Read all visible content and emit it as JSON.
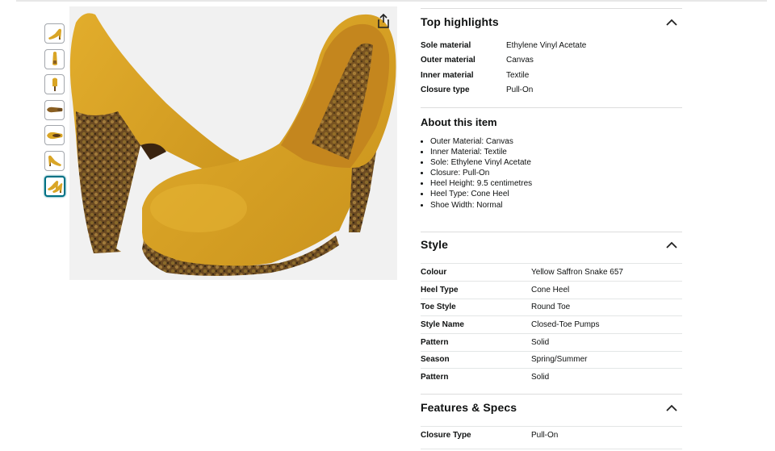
{
  "share": {
    "icon": "share-icon"
  },
  "thumbnails": [
    {
      "icon": "shoe-side-icon",
      "selected": false
    },
    {
      "icon": "shoe-front-icon",
      "selected": false
    },
    {
      "icon": "shoe-back-icon",
      "selected": false
    },
    {
      "icon": "shoe-sole-icon",
      "selected": false
    },
    {
      "icon": "shoe-top-icon",
      "selected": false
    },
    {
      "icon": "shoe-side-icon",
      "selected": false
    },
    {
      "icon": "shoe-pair-icon",
      "selected": true
    }
  ],
  "top_highlights": {
    "title": "Top highlights",
    "rows": [
      {
        "label": "Sole material",
        "value": "Ethylene Vinyl Acetate"
      },
      {
        "label": "Outer material",
        "value": "Canvas"
      },
      {
        "label": "Inner material",
        "value": "Textile"
      },
      {
        "label": "Closure type",
        "value": "Pull-On"
      }
    ]
  },
  "about": {
    "title": "About this item",
    "bullets": [
      "Outer Material: Canvas",
      "Inner Material: Textile",
      "Sole: Ethylene Vinyl Acetate",
      "Closure: Pull-On",
      "Heel Height: 9.5 centimetres",
      "Heel Type: Cone Heel",
      "Shoe Width: Normal"
    ]
  },
  "style": {
    "title": "Style",
    "rows": [
      {
        "label": "Colour",
        "value": "Yellow Saffron Snake 657"
      },
      {
        "label": "Heel Type",
        "value": "Cone Heel"
      },
      {
        "label": "Toe Style",
        "value": "Round Toe"
      },
      {
        "label": "Style Name",
        "value": "Closed-Toe Pumps"
      },
      {
        "label": "Pattern",
        "value": "Solid"
      },
      {
        "label": "Season",
        "value": "Spring/Summer"
      },
      {
        "label": "Pattern",
        "value": "Solid"
      }
    ]
  },
  "features": {
    "title": "Features & Specs",
    "rows": [
      {
        "label": "Closure Type",
        "value": "Pull-On"
      }
    ]
  },
  "colors": {
    "shoe": "#d9a526",
    "shoe_shadow": "#b8841a",
    "snake": "#6b4a22",
    "selected_border": "#007185"
  }
}
